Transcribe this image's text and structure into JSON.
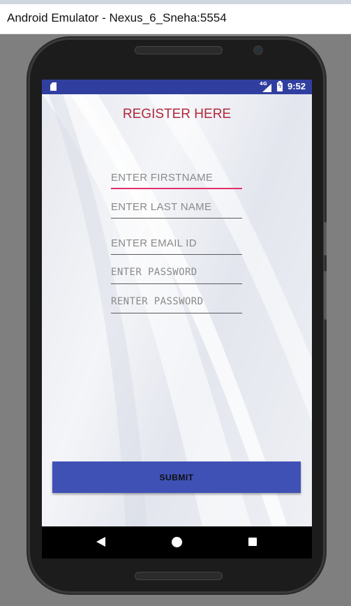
{
  "window": {
    "title": "Android Emulator - Nexus_6_Sneha:5554"
  },
  "status_bar": {
    "time": "9:52",
    "network": "4G",
    "icons": [
      "sd-card-icon",
      "signal-icon",
      "battery-charging-icon"
    ],
    "background": "#303f9f"
  },
  "form": {
    "heading": "REGISTER HERE",
    "firstname_placeholder": "ENTER FIRSTNAME",
    "lastname_placeholder": "ENTER LAST NAME",
    "email_placeholder": "ENTER EMAIL ID",
    "password_placeholder": "ENTER PASSWORD",
    "repassword_placeholder": "RENTER PASSWORD",
    "submit_label": "SUBMIT"
  },
  "colors": {
    "accent": "#e0306a",
    "primary": "#3f51b5",
    "heading": "#b0283c"
  },
  "nav_bar": {
    "icons": [
      "back-icon",
      "home-icon",
      "recent-apps-icon"
    ]
  }
}
